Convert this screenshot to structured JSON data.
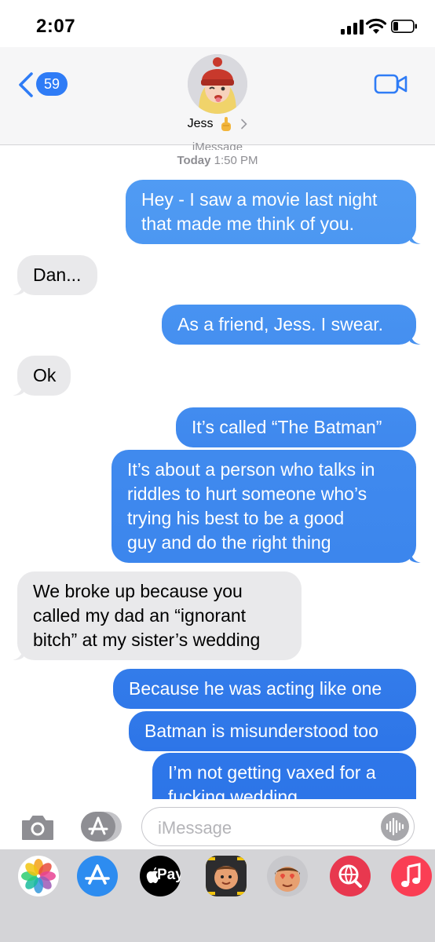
{
  "status_bar": {
    "time": "2:07"
  },
  "header": {
    "back_count": "59",
    "contact_name": "Jess"
  },
  "thread": {
    "service": "iMessage",
    "timestamp_day": "Today",
    "timestamp_time": "1:50 PM",
    "messages": [
      {
        "from": "me",
        "lines": [
          "Hey - I saw a movie last night",
          "that made me think of you."
        ]
      },
      {
        "from": "them",
        "lines": [
          "Dan..."
        ]
      },
      {
        "from": "me",
        "lines": [
          "As a friend, Jess. I swear."
        ]
      },
      {
        "from": "them",
        "lines": [
          "Ok"
        ]
      },
      {
        "from": "me",
        "lines": [
          "It’s called “The Batman”"
        ]
      },
      {
        "from": "me",
        "lines": [
          "It’s about a person who talks in",
          "riddles to hurt someone who’s",
          "trying his best to be a good",
          "guy and do the right thing"
        ]
      },
      {
        "from": "them",
        "lines": [
          "We broke up because you",
          "called my dad an “ignorant",
          "bitch” at my sister’s wedding"
        ]
      },
      {
        "from": "me",
        "lines": [
          "Because he was acting like one"
        ]
      },
      {
        "from": "me",
        "lines": [
          "Batman is misunderstood too"
        ]
      },
      {
        "from": "me",
        "lines": [
          "I’m not getting vaxed for a",
          "fucking wedding"
        ]
      }
    ]
  },
  "compose": {
    "placeholder": "iMessage"
  },
  "app_drawer": {
    "apple_pay_label": "Pay",
    "apps": [
      "photos-app",
      "app-store-app",
      "apple-pay-app",
      "memoji-app",
      "memoji-stickers-app",
      "web-images-app",
      "music-app"
    ]
  },
  "colors": {
    "sent_top": "#5aa6f6",
    "sent_bottom": "#2c74e8",
    "received": "#e9e9eb",
    "accent": "#2f7cf6"
  }
}
